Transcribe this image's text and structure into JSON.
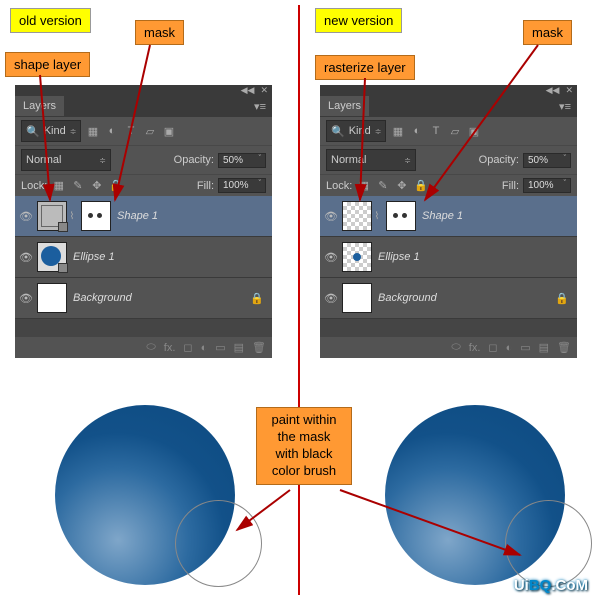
{
  "labels": {
    "old_version": "old version",
    "new_version": "new version",
    "mask_left": "mask",
    "mask_right": "mask",
    "shape_layer": "shape layer",
    "rasterize_layer": "rasterize layer",
    "paint_hint": "paint within the mask with black color brush"
  },
  "panel": {
    "tab": "Layers",
    "kind": "Kind",
    "blend_mode": "Normal",
    "opacity_label": "Opacity:",
    "opacity_value": "50%",
    "lock_label": "Lock:",
    "fill_label": "Fill:",
    "fill_value": "100%",
    "fx_label": "fx.",
    "layers": {
      "shape1": "Shape 1",
      "ellipse1": "Ellipse 1",
      "background": "Background"
    }
  },
  "watermark": "UiBQ.CoM"
}
